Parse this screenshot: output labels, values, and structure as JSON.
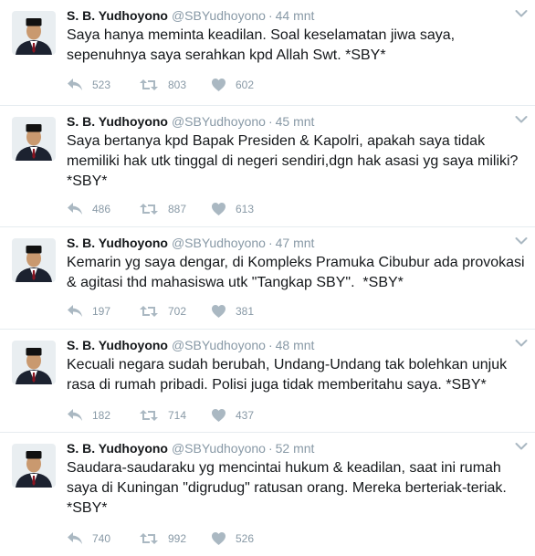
{
  "tweets": [
    {
      "name": "S. B. Yudhoyono",
      "handle": "@SBYudhoyono",
      "dot": "·",
      "time": "44 mnt",
      "text": "Saya hanya meminta keadilan. Soal keselamatan jiwa saya, sepenuhnya saya serahkan kpd Allah Swt. *SBY*",
      "replies": "523",
      "retweets": "803",
      "likes": "602"
    },
    {
      "name": "S. B. Yudhoyono",
      "handle": "@SBYudhoyono",
      "dot": "·",
      "time": "45 mnt",
      "text": "Saya bertanya kpd Bapak Presiden & Kapolri, apakah saya tidak memiliki hak utk tinggal di negeri sendiri,dgn hak asasi yg saya miliki? *SBY*",
      "replies": "486",
      "retweets": "887",
      "likes": "613"
    },
    {
      "name": "S. B. Yudhoyono",
      "handle": "@SBYudhoyono",
      "dot": "·",
      "time": "47 mnt",
      "text": "Kemarin yg saya dengar, di Kompleks Pramuka Cibubur ada provokasi & agitasi thd mahasiswa utk \"Tangkap SBY\".  *SBY*",
      "replies": "197",
      "retweets": "702",
      "likes": "381"
    },
    {
      "name": "S. B. Yudhoyono",
      "handle": "@SBYudhoyono",
      "dot": "·",
      "time": "48 mnt",
      "text": "Kecuali negara sudah berubah, Undang-Undang tak bolehkan unjuk rasa di rumah pribadi. Polisi juga tidak memberitahu saya. *SBY*",
      "replies": "182",
      "retweets": "714",
      "likes": "437"
    },
    {
      "name": "S. B. Yudhoyono",
      "handle": "@SBYudhoyono",
      "dot": "·",
      "time": "52 mnt",
      "text": "Saudara-saudaraku yg mencintai hukum & keadilan, saat ini rumah saya di Kuningan \"digrudug\" ratusan orang. Mereka berteriak-teriak. *SBY*",
      "replies": "740",
      "retweets": "992",
      "likes": "526"
    }
  ],
  "icons": {
    "avatar": "avatar-photo",
    "caret": "chevron-down-icon",
    "reply": "reply-icon",
    "retweet": "retweet-icon",
    "like": "heart-icon"
  },
  "colors": {
    "text": "#14171a",
    "muted": "#8899a6",
    "divider": "#e6ecf0"
  }
}
